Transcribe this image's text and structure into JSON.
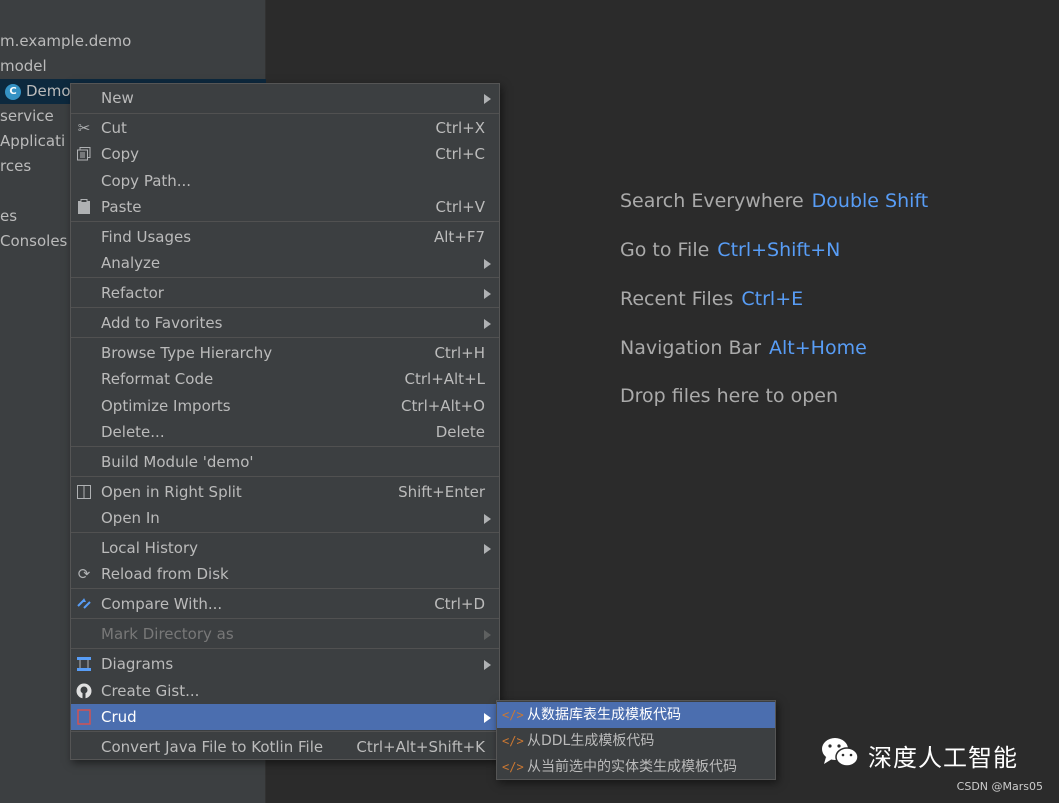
{
  "project_tree": {
    "rows": [
      {
        "text": "m.example.demo"
      },
      {
        "text": " model"
      },
      {
        "text": "Demo",
        "icon": "C"
      },
      {
        "text": " service"
      },
      {
        "text": " Applicati"
      },
      {
        "text": "rces"
      },
      {
        "text": ""
      },
      {
        "text": "es"
      },
      {
        "text": "Consoles"
      }
    ]
  },
  "editor_hints": [
    {
      "label": "Search Everywhere",
      "key": "Double Shift"
    },
    {
      "label": "Go to File",
      "key": "Ctrl+Shift+N"
    },
    {
      "label": "Recent Files",
      "key": "Ctrl+E"
    },
    {
      "label": "Navigation Bar",
      "key": "Alt+Home"
    },
    {
      "label": "Drop files here to open",
      "key": ""
    }
  ],
  "context_menu": {
    "items": [
      {
        "label": "New",
        "shortcut": "",
        "submenu": true,
        "icon": ""
      },
      {
        "label": "Cut",
        "shortcut": "Ctrl+X",
        "icon": "scissors-icon"
      },
      {
        "label": "Copy",
        "shortcut": "Ctrl+C",
        "icon": "copy-icon"
      },
      {
        "label": "Copy Path...",
        "shortcut": "",
        "icon": ""
      },
      {
        "label": "Paste",
        "shortcut": "Ctrl+V",
        "icon": "clipboard-icon"
      },
      {
        "label": "Find Usages",
        "shortcut": "Alt+F7",
        "icon": ""
      },
      {
        "label": "Analyze",
        "shortcut": "",
        "submenu": true,
        "icon": ""
      },
      {
        "label": "Refactor",
        "shortcut": "",
        "submenu": true,
        "icon": ""
      },
      {
        "label": "Add to Favorites",
        "shortcut": "",
        "submenu": true,
        "icon": ""
      },
      {
        "label": "Browse Type Hierarchy",
        "shortcut": "Ctrl+H",
        "icon": ""
      },
      {
        "label": "Reformat Code",
        "shortcut": "Ctrl+Alt+L",
        "icon": ""
      },
      {
        "label": "Optimize Imports",
        "shortcut": "Ctrl+Alt+O",
        "icon": ""
      },
      {
        "label": "Delete...",
        "shortcut": "Delete",
        "icon": ""
      },
      {
        "label": "Build Module 'demo'",
        "shortcut": "",
        "icon": ""
      },
      {
        "label": "Open in Right Split",
        "shortcut": "Shift+Enter",
        "icon": "split-icon"
      },
      {
        "label": "Open In",
        "shortcut": "",
        "submenu": true,
        "icon": ""
      },
      {
        "label": "Local History",
        "shortcut": "",
        "submenu": true,
        "icon": ""
      },
      {
        "label": "Reload from Disk",
        "shortcut": "",
        "icon": "reload-icon"
      },
      {
        "label": "Compare With...",
        "shortcut": "Ctrl+D",
        "icon": "compare-icon"
      },
      {
        "label": "Mark Directory as",
        "shortcut": "",
        "submenu": true,
        "disabled": true,
        "icon": ""
      },
      {
        "label": "Diagrams",
        "shortcut": "",
        "submenu": true,
        "icon": "diagram-icon"
      },
      {
        "label": "Create Gist...",
        "shortcut": "",
        "icon": "github-icon"
      },
      {
        "label": "Crud",
        "shortcut": "",
        "submenu": true,
        "highlighted": true,
        "icon": "crud-icon"
      },
      {
        "label": "Convert Java File to Kotlin File",
        "shortcut": "Ctrl+Alt+Shift+K",
        "icon": ""
      }
    ]
  },
  "crud_submenu": {
    "items": [
      {
        "label": "从数据库表生成模板代码",
        "highlighted": true
      },
      {
        "label": "从DDL生成模板代码"
      },
      {
        "label": "从当前选中的实体类生成模板代码"
      }
    ]
  },
  "watermark": {
    "text": "深度人工智能",
    "credit": "CSDN @Mars05"
  },
  "colors": {
    "accent": "#4b6eaf",
    "shortcut_key": "#589df6",
    "background": "#2b2b2b",
    "panel": "#3c3f41"
  }
}
